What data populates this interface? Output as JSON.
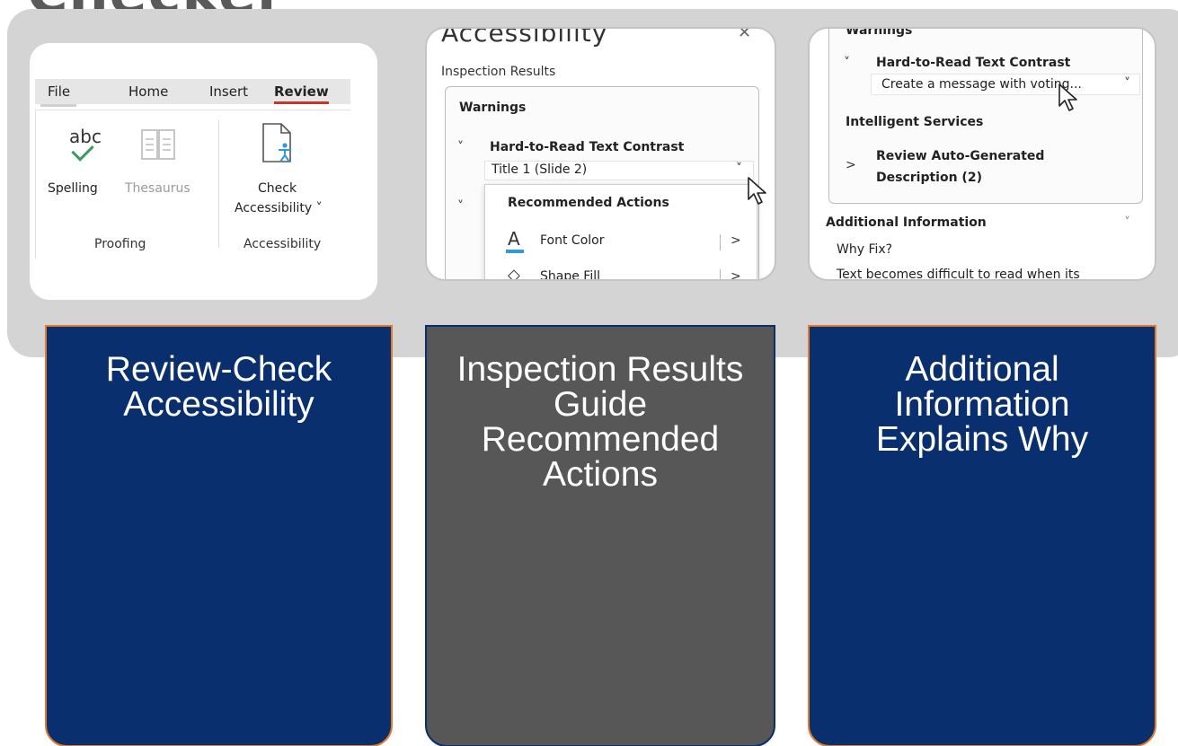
{
  "slide": {
    "title_fragment": "Checker"
  },
  "ribbon": {
    "tabs": [
      "File",
      "Home",
      "Insert",
      "Review"
    ],
    "active_tab": "Review",
    "spelling_icon_text": "abc",
    "spelling_label": "Spelling",
    "thesaurus_label": "Thesaurus",
    "check_label_line1": "Check",
    "check_label_line2": "Accessibility ˅",
    "group_proofing": "Proofing",
    "group_accessibility": "Accessibility"
  },
  "inspection_pane": {
    "title": "Accessibility",
    "close_glyph": "✕",
    "inspection_results_label": "Inspection Results",
    "warnings_label": "Warnings",
    "issue_label": "Hard-to-Read Text Contrast",
    "slide_item": "Title 1  (Slide 2)",
    "recommended_actions_label": "Recommended Actions",
    "actions": [
      {
        "label": "Font Color",
        "icon": "font-color-icon"
      },
      {
        "label": "Shape Fill",
        "icon": "shape-fill-icon"
      }
    ],
    "accent_color": "#2e9ad6"
  },
  "additional_pane": {
    "warnings_label": "Warnings",
    "issue_label": "Hard-to-Read Text Contrast",
    "message_item": "Create a message with voting...",
    "intelligent_services_label": "Intelligent Services",
    "review_label_line1": "Review Auto-Generated",
    "review_label_line2": "Description (2)",
    "additional_info_label": "Additional Information",
    "why_fix_label": "Why Fix?",
    "why_fix_text": "Text becomes difficult to read when its"
  },
  "cards": [
    {
      "text": "Review-Check Accessibility",
      "color": "#0a2f6e"
    },
    {
      "text": "Inspection Results Guide Recommended Actions",
      "color": "#575757"
    },
    {
      "text": "Additional Information Explains Why",
      "color": "#0a2f6e"
    }
  ],
  "colors": {
    "band": "#d4d4d4",
    "card_border_orange": "#e07a2e",
    "review_underline": "#c0392b"
  }
}
